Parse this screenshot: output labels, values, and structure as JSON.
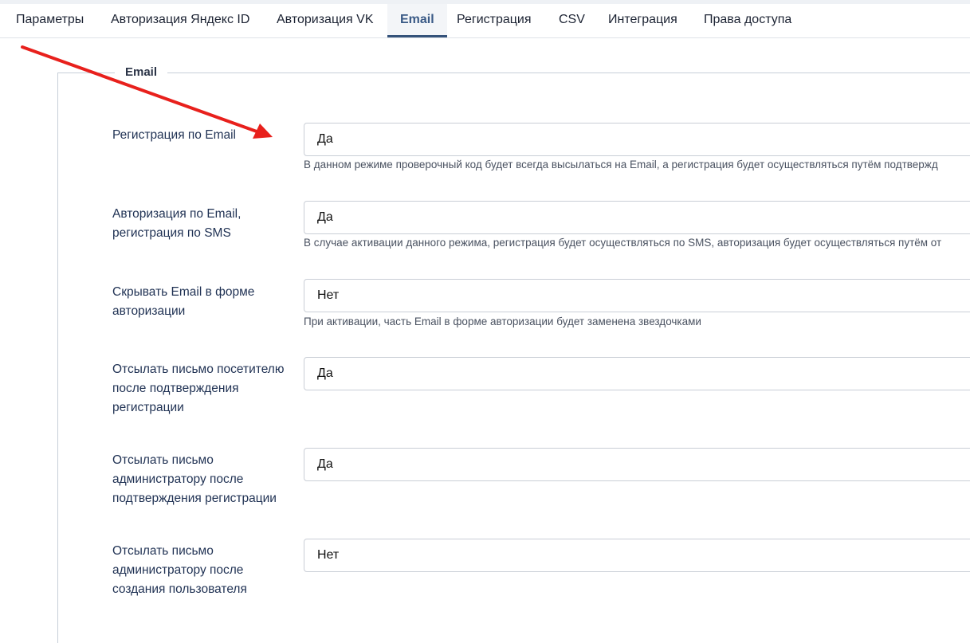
{
  "tabs": [
    {
      "label": "Параметры"
    },
    {
      "label": "Авторизация Яндекс ID"
    },
    {
      "label": "Авторизация VK"
    },
    {
      "label": "Email"
    },
    {
      "label": "Регистрация"
    },
    {
      "label": "CSV"
    },
    {
      "label": "Интеграция"
    },
    {
      "label": "Права доступа"
    }
  ],
  "fieldset": {
    "legend": "Email",
    "rows": [
      {
        "label": "Регистрация по Email",
        "value": "Да",
        "hint": "В данном режиме проверочный код будет всегда высылаться на Email, а регистрация будет осуществляться путём подтвержд"
      },
      {
        "label": "Авторизация по Email, регистрация по SMS",
        "value": "Да",
        "hint": "В случае активации данного режима, регистрация будет осуществляться по SMS, авторизация будет осуществляться путём от"
      },
      {
        "label": "Скрывать Email в форме авторизации",
        "value": "Нет",
        "hint": "При активации, часть Email в форме авторизации будет заменена звездочками"
      },
      {
        "label": "Отсылать письмо посетителю после подтверждения регистрации",
        "value": "Да"
      },
      {
        "label": "Отсылать письмо администратору после подтверждения регистрации",
        "value": "Да"
      },
      {
        "label": "Отсылать письмо администратору после создания пользователя",
        "value": "Нет"
      }
    ]
  },
  "annotation": {
    "arrow_color": "#e8201c"
  }
}
